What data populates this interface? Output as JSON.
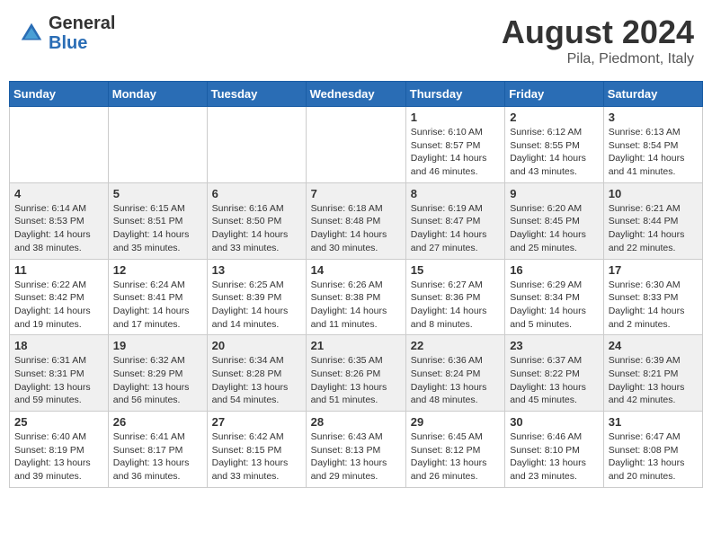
{
  "header": {
    "logo_general": "General",
    "logo_blue": "Blue",
    "month_year": "August 2024",
    "location": "Pila, Piedmont, Italy"
  },
  "days_of_week": [
    "Sunday",
    "Monday",
    "Tuesday",
    "Wednesday",
    "Thursday",
    "Friday",
    "Saturday"
  ],
  "weeks": [
    [
      {
        "day": "",
        "info": ""
      },
      {
        "day": "",
        "info": ""
      },
      {
        "day": "",
        "info": ""
      },
      {
        "day": "",
        "info": ""
      },
      {
        "day": "1",
        "info": "Sunrise: 6:10 AM\nSunset: 8:57 PM\nDaylight: 14 hours and 46 minutes."
      },
      {
        "day": "2",
        "info": "Sunrise: 6:12 AM\nSunset: 8:55 PM\nDaylight: 14 hours and 43 minutes."
      },
      {
        "day": "3",
        "info": "Sunrise: 6:13 AM\nSunset: 8:54 PM\nDaylight: 14 hours and 41 minutes."
      }
    ],
    [
      {
        "day": "4",
        "info": "Sunrise: 6:14 AM\nSunset: 8:53 PM\nDaylight: 14 hours and 38 minutes."
      },
      {
        "day": "5",
        "info": "Sunrise: 6:15 AM\nSunset: 8:51 PM\nDaylight: 14 hours and 35 minutes."
      },
      {
        "day": "6",
        "info": "Sunrise: 6:16 AM\nSunset: 8:50 PM\nDaylight: 14 hours and 33 minutes."
      },
      {
        "day": "7",
        "info": "Sunrise: 6:18 AM\nSunset: 8:48 PM\nDaylight: 14 hours and 30 minutes."
      },
      {
        "day": "8",
        "info": "Sunrise: 6:19 AM\nSunset: 8:47 PM\nDaylight: 14 hours and 27 minutes."
      },
      {
        "day": "9",
        "info": "Sunrise: 6:20 AM\nSunset: 8:45 PM\nDaylight: 14 hours and 25 minutes."
      },
      {
        "day": "10",
        "info": "Sunrise: 6:21 AM\nSunset: 8:44 PM\nDaylight: 14 hours and 22 minutes."
      }
    ],
    [
      {
        "day": "11",
        "info": "Sunrise: 6:22 AM\nSunset: 8:42 PM\nDaylight: 14 hours and 19 minutes."
      },
      {
        "day": "12",
        "info": "Sunrise: 6:24 AM\nSunset: 8:41 PM\nDaylight: 14 hours and 17 minutes."
      },
      {
        "day": "13",
        "info": "Sunrise: 6:25 AM\nSunset: 8:39 PM\nDaylight: 14 hours and 14 minutes."
      },
      {
        "day": "14",
        "info": "Sunrise: 6:26 AM\nSunset: 8:38 PM\nDaylight: 14 hours and 11 minutes."
      },
      {
        "day": "15",
        "info": "Sunrise: 6:27 AM\nSunset: 8:36 PM\nDaylight: 14 hours and 8 minutes."
      },
      {
        "day": "16",
        "info": "Sunrise: 6:29 AM\nSunset: 8:34 PM\nDaylight: 14 hours and 5 minutes."
      },
      {
        "day": "17",
        "info": "Sunrise: 6:30 AM\nSunset: 8:33 PM\nDaylight: 14 hours and 2 minutes."
      }
    ],
    [
      {
        "day": "18",
        "info": "Sunrise: 6:31 AM\nSunset: 8:31 PM\nDaylight: 13 hours and 59 minutes."
      },
      {
        "day": "19",
        "info": "Sunrise: 6:32 AM\nSunset: 8:29 PM\nDaylight: 13 hours and 56 minutes."
      },
      {
        "day": "20",
        "info": "Sunrise: 6:34 AM\nSunset: 8:28 PM\nDaylight: 13 hours and 54 minutes."
      },
      {
        "day": "21",
        "info": "Sunrise: 6:35 AM\nSunset: 8:26 PM\nDaylight: 13 hours and 51 minutes."
      },
      {
        "day": "22",
        "info": "Sunrise: 6:36 AM\nSunset: 8:24 PM\nDaylight: 13 hours and 48 minutes."
      },
      {
        "day": "23",
        "info": "Sunrise: 6:37 AM\nSunset: 8:22 PM\nDaylight: 13 hours and 45 minutes."
      },
      {
        "day": "24",
        "info": "Sunrise: 6:39 AM\nSunset: 8:21 PM\nDaylight: 13 hours and 42 minutes."
      }
    ],
    [
      {
        "day": "25",
        "info": "Sunrise: 6:40 AM\nSunset: 8:19 PM\nDaylight: 13 hours and 39 minutes."
      },
      {
        "day": "26",
        "info": "Sunrise: 6:41 AM\nSunset: 8:17 PM\nDaylight: 13 hours and 36 minutes."
      },
      {
        "day": "27",
        "info": "Sunrise: 6:42 AM\nSunset: 8:15 PM\nDaylight: 13 hours and 33 minutes."
      },
      {
        "day": "28",
        "info": "Sunrise: 6:43 AM\nSunset: 8:13 PM\nDaylight: 13 hours and 29 minutes."
      },
      {
        "day": "29",
        "info": "Sunrise: 6:45 AM\nSunset: 8:12 PM\nDaylight: 13 hours and 26 minutes."
      },
      {
        "day": "30",
        "info": "Sunrise: 6:46 AM\nSunset: 8:10 PM\nDaylight: 13 hours and 23 minutes."
      },
      {
        "day": "31",
        "info": "Sunrise: 6:47 AM\nSunset: 8:08 PM\nDaylight: 13 hours and 20 minutes."
      }
    ]
  ]
}
